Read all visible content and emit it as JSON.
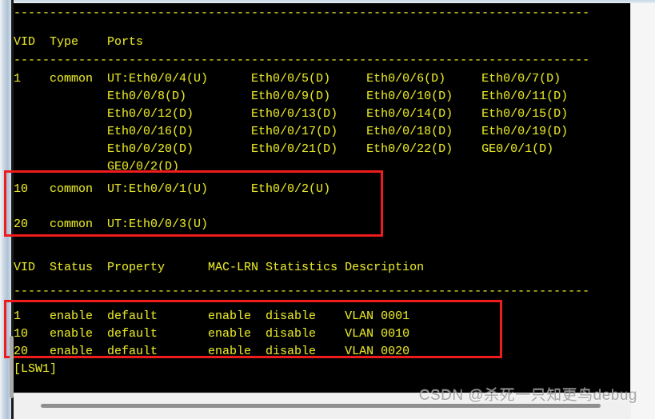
{
  "terminal": {
    "prompt": "[LSW1]",
    "separator": "--------------------------------------------------------------------------------",
    "vlan_ports_table": {
      "header": "VID  Type    Ports",
      "rows": [
        "1    common  UT:Eth0/0/4(U)      Eth0/0/5(D)     Eth0/0/6(D)     Eth0/0/7(D)",
        "             Eth0/0/8(D)         Eth0/0/9(D)     Eth0/0/10(D)    Eth0/0/11(D)",
        "             Eth0/0/12(D)        Eth0/0/13(D)    Eth0/0/14(D)    Eth0/0/15(D)",
        "             Eth0/0/16(D)        Eth0/0/17(D)    Eth0/0/18(D)    Eth0/0/19(D)",
        "             Eth0/0/20(D)        Eth0/0/21(D)    Eth0/0/22(D)    GE0/0/1(D)",
        "             GE0/0/2(D)"
      ],
      "highlighted_rows": [
        "10   common  UT:Eth0/0/1(U)      Eth0/0/2(U)",
        "20   common  UT:Eth0/0/3(U)"
      ]
    },
    "vlan_status_table": {
      "header": "VID  Status  Property      MAC-LRN Statistics Description",
      "highlighted_rows": [
        "1    enable  default       enable  disable    VLAN 0001",
        "10   enable  default       enable  disable    VLAN 0010",
        "20   enable  default       enable  disable    VLAN 0020"
      ]
    }
  },
  "watermark": {
    "text": "CSDN @杀死一只知更鸟debug"
  },
  "colors": {
    "terminal_bg": "#000000",
    "terminal_text": "#e3e32a",
    "highlight_box": "#ee1c1c"
  }
}
